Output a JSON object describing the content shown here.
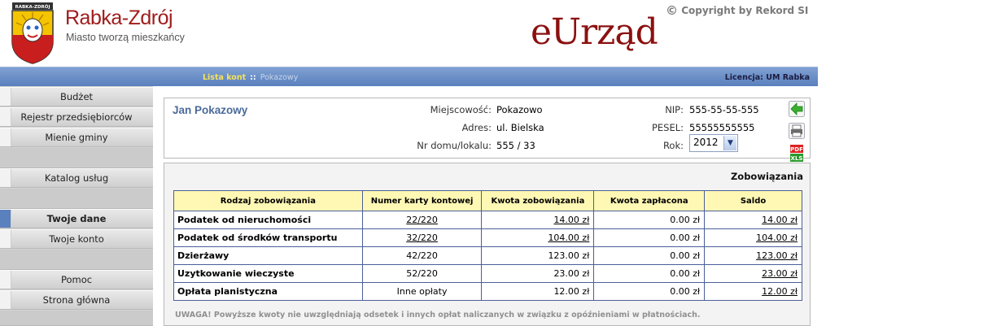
{
  "header": {
    "city": "Rabka-Zdrój",
    "motto": "Miasto tworzą mieszkańcy",
    "crest_text": "RABKA-ZDRÓJ",
    "app_title": "eUrząd",
    "copyright_symbol": "©",
    "copyright": "Copyright by Rekord SI"
  },
  "nav": {
    "breadcrumb_link": "Lista kont",
    "breadcrumb_sep": "::",
    "breadcrumb_current": "Pokazowy",
    "license": "Licencja: UM Rabka"
  },
  "sidebar": {
    "items": [
      {
        "label": "Budżet"
      },
      {
        "label": "Rejestr przedsiębiorców"
      },
      {
        "label": "Mienie gminy"
      },
      {
        "label": "Katalog usług"
      },
      {
        "label": "Twoje dane",
        "active": true
      },
      {
        "label": "Twoje konto"
      },
      {
        "label": "Pomoc"
      },
      {
        "label": "Strona główna"
      }
    ],
    "accent": "#5a80bd"
  },
  "person": {
    "name": "Jan Pokazowy",
    "miejscowosc_label": "Miejscowość:",
    "miejscowosc": "Pokazowo",
    "adres_label": "Adres:",
    "adres": "ul. Bielska",
    "nr_label": "Nr domu/lokalu:",
    "nr": "555 / 33",
    "nip_label": "NIP:",
    "nip": "555-55-55-555",
    "pesel_label": "PESEL:",
    "pesel": "55555555555",
    "rok_label": "Rok:",
    "rok": "2012"
  },
  "obligations": {
    "title": "Zobowiązania",
    "columns": [
      "Rodzaj zobowiązania",
      "Numer karty kontowej",
      "Kwota zobowiązania",
      "Kwota zapłacona",
      "Saldo"
    ],
    "rows": [
      {
        "name": "Podatek od nieruchomości",
        "card": "22/220",
        "amount": "14.00 zł",
        "paid": "0.00 zł",
        "saldo": "14.00 zł"
      },
      {
        "name": "Podatek od środków transportu",
        "card": "32/220",
        "amount": "104.00 zł",
        "paid": "0.00 zł",
        "saldo": "104.00 zł"
      },
      {
        "name": "Dzierżawy",
        "card": "42/220",
        "amount": "123.00 zł",
        "paid": "0.00 zł",
        "saldo": "123.00 zł"
      },
      {
        "name": "Uzytkowanie wieczyste",
        "card": "52/220",
        "amount": "23.00 zł",
        "paid": "0.00 zł",
        "saldo": "23.00 zł"
      },
      {
        "name": "Opłata planistyczna",
        "card": "Inne opłaty",
        "amount": "12.00 zł",
        "paid": "0.00 zł",
        "saldo": "12.00 zł"
      }
    ],
    "warning": "UWAGA! Powyższe kwoty nie uwzględniają odsetek i innych opłat naliczanych w związku z opóźnieniami w płatnościach."
  },
  "icons": {
    "back": "back-arrow-icon",
    "print": "printer-icon",
    "pdf": "pdf-icon",
    "xls": "xls-icon"
  },
  "colors": {
    "brand_red": "#a01c1c",
    "eurzad_red": "#8b1010",
    "nav_blue": "#5a80bd",
    "header_yellow": "#fff8b4",
    "table_border": "#4a5f99",
    "name_blue": "#4a6a9a"
  }
}
